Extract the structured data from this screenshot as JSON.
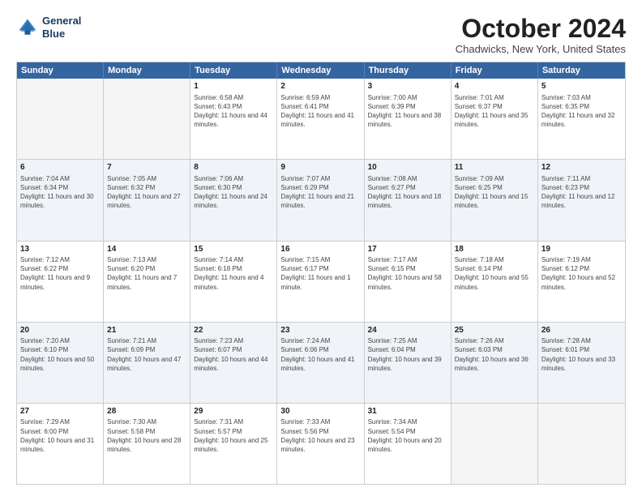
{
  "logo": {
    "line1": "General",
    "line2": "Blue"
  },
  "title": "October 2024",
  "location": "Chadwicks, New York, United States",
  "days_of_week": [
    "Sunday",
    "Monday",
    "Tuesday",
    "Wednesday",
    "Thursday",
    "Friday",
    "Saturday"
  ],
  "rows": [
    [
      {
        "day": "",
        "empty": true
      },
      {
        "day": "",
        "empty": true
      },
      {
        "day": "1",
        "sunrise": "6:58 AM",
        "sunset": "6:43 PM",
        "daylight": "11 hours and 44 minutes."
      },
      {
        "day": "2",
        "sunrise": "6:59 AM",
        "sunset": "6:41 PM",
        "daylight": "11 hours and 41 minutes."
      },
      {
        "day": "3",
        "sunrise": "7:00 AM",
        "sunset": "6:39 PM",
        "daylight": "11 hours and 38 minutes."
      },
      {
        "day": "4",
        "sunrise": "7:01 AM",
        "sunset": "6:37 PM",
        "daylight": "11 hours and 35 minutes."
      },
      {
        "day": "5",
        "sunrise": "7:03 AM",
        "sunset": "6:35 PM",
        "daylight": "11 hours and 32 minutes."
      }
    ],
    [
      {
        "day": "6",
        "sunrise": "7:04 AM",
        "sunset": "6:34 PM",
        "daylight": "11 hours and 30 minutes."
      },
      {
        "day": "7",
        "sunrise": "7:05 AM",
        "sunset": "6:32 PM",
        "daylight": "11 hours and 27 minutes."
      },
      {
        "day": "8",
        "sunrise": "7:06 AM",
        "sunset": "6:30 PM",
        "daylight": "11 hours and 24 minutes."
      },
      {
        "day": "9",
        "sunrise": "7:07 AM",
        "sunset": "6:29 PM",
        "daylight": "11 hours and 21 minutes."
      },
      {
        "day": "10",
        "sunrise": "7:08 AM",
        "sunset": "6:27 PM",
        "daylight": "11 hours and 18 minutes."
      },
      {
        "day": "11",
        "sunrise": "7:09 AM",
        "sunset": "6:25 PM",
        "daylight": "11 hours and 15 minutes."
      },
      {
        "day": "12",
        "sunrise": "7:11 AM",
        "sunset": "6:23 PM",
        "daylight": "11 hours and 12 minutes."
      }
    ],
    [
      {
        "day": "13",
        "sunrise": "7:12 AM",
        "sunset": "6:22 PM",
        "daylight": "11 hours and 9 minutes."
      },
      {
        "day": "14",
        "sunrise": "7:13 AM",
        "sunset": "6:20 PM",
        "daylight": "11 hours and 7 minutes."
      },
      {
        "day": "15",
        "sunrise": "7:14 AM",
        "sunset": "6:18 PM",
        "daylight": "11 hours and 4 minutes."
      },
      {
        "day": "16",
        "sunrise": "7:15 AM",
        "sunset": "6:17 PM",
        "daylight": "11 hours and 1 minute."
      },
      {
        "day": "17",
        "sunrise": "7:17 AM",
        "sunset": "6:15 PM",
        "daylight": "10 hours and 58 minutes."
      },
      {
        "day": "18",
        "sunrise": "7:18 AM",
        "sunset": "6:14 PM",
        "daylight": "10 hours and 55 minutes."
      },
      {
        "day": "19",
        "sunrise": "7:19 AM",
        "sunset": "6:12 PM",
        "daylight": "10 hours and 52 minutes."
      }
    ],
    [
      {
        "day": "20",
        "sunrise": "7:20 AM",
        "sunset": "6:10 PM",
        "daylight": "10 hours and 50 minutes."
      },
      {
        "day": "21",
        "sunrise": "7:21 AM",
        "sunset": "6:09 PM",
        "daylight": "10 hours and 47 minutes."
      },
      {
        "day": "22",
        "sunrise": "7:23 AM",
        "sunset": "6:07 PM",
        "daylight": "10 hours and 44 minutes."
      },
      {
        "day": "23",
        "sunrise": "7:24 AM",
        "sunset": "6:06 PM",
        "daylight": "10 hours and 41 minutes."
      },
      {
        "day": "24",
        "sunrise": "7:25 AM",
        "sunset": "6:04 PM",
        "daylight": "10 hours and 39 minutes."
      },
      {
        "day": "25",
        "sunrise": "7:26 AM",
        "sunset": "6:03 PM",
        "daylight": "10 hours and 36 minutes."
      },
      {
        "day": "26",
        "sunrise": "7:28 AM",
        "sunset": "6:01 PM",
        "daylight": "10 hours and 33 minutes."
      }
    ],
    [
      {
        "day": "27",
        "sunrise": "7:29 AM",
        "sunset": "6:00 PM",
        "daylight": "10 hours and 31 minutes."
      },
      {
        "day": "28",
        "sunrise": "7:30 AM",
        "sunset": "5:58 PM",
        "daylight": "10 hours and 28 minutes."
      },
      {
        "day": "29",
        "sunrise": "7:31 AM",
        "sunset": "5:57 PM",
        "daylight": "10 hours and 25 minutes."
      },
      {
        "day": "30",
        "sunrise": "7:33 AM",
        "sunset": "5:56 PM",
        "daylight": "10 hours and 23 minutes."
      },
      {
        "day": "31",
        "sunrise": "7:34 AM",
        "sunset": "5:54 PM",
        "daylight": "10 hours and 20 minutes."
      },
      {
        "day": "",
        "empty": true
      },
      {
        "day": "",
        "empty": true
      }
    ]
  ]
}
